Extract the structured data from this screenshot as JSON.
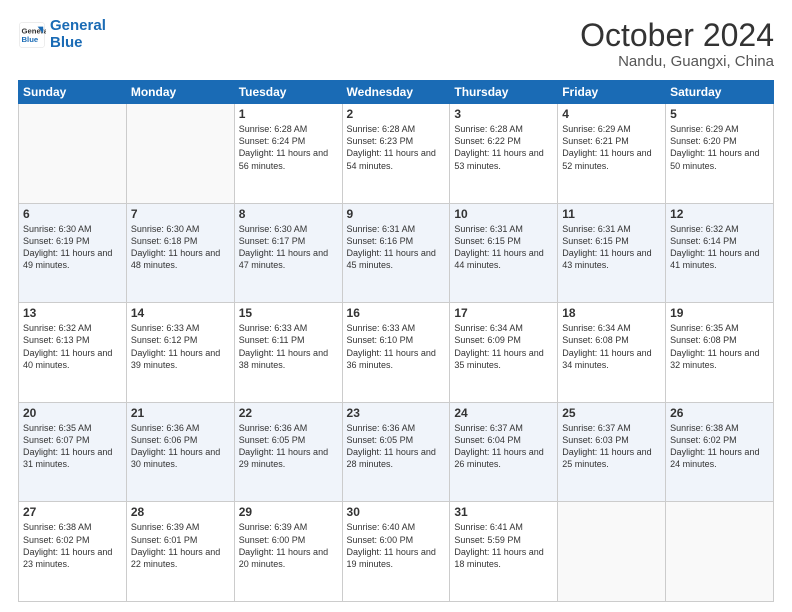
{
  "header": {
    "logo_line1": "General",
    "logo_line2": "Blue",
    "month": "October 2024",
    "location": "Nandu, Guangxi, China"
  },
  "weekdays": [
    "Sunday",
    "Monday",
    "Tuesday",
    "Wednesday",
    "Thursday",
    "Friday",
    "Saturday"
  ],
  "weeks": [
    [
      {
        "day": "",
        "info": ""
      },
      {
        "day": "",
        "info": ""
      },
      {
        "day": "1",
        "info": "Sunrise: 6:28 AM\nSunset: 6:24 PM\nDaylight: 11 hours and 56 minutes."
      },
      {
        "day": "2",
        "info": "Sunrise: 6:28 AM\nSunset: 6:23 PM\nDaylight: 11 hours and 54 minutes."
      },
      {
        "day": "3",
        "info": "Sunrise: 6:28 AM\nSunset: 6:22 PM\nDaylight: 11 hours and 53 minutes."
      },
      {
        "day": "4",
        "info": "Sunrise: 6:29 AM\nSunset: 6:21 PM\nDaylight: 11 hours and 52 minutes."
      },
      {
        "day": "5",
        "info": "Sunrise: 6:29 AM\nSunset: 6:20 PM\nDaylight: 11 hours and 50 minutes."
      }
    ],
    [
      {
        "day": "6",
        "info": "Sunrise: 6:30 AM\nSunset: 6:19 PM\nDaylight: 11 hours and 49 minutes."
      },
      {
        "day": "7",
        "info": "Sunrise: 6:30 AM\nSunset: 6:18 PM\nDaylight: 11 hours and 48 minutes."
      },
      {
        "day": "8",
        "info": "Sunrise: 6:30 AM\nSunset: 6:17 PM\nDaylight: 11 hours and 47 minutes."
      },
      {
        "day": "9",
        "info": "Sunrise: 6:31 AM\nSunset: 6:16 PM\nDaylight: 11 hours and 45 minutes."
      },
      {
        "day": "10",
        "info": "Sunrise: 6:31 AM\nSunset: 6:15 PM\nDaylight: 11 hours and 44 minutes."
      },
      {
        "day": "11",
        "info": "Sunrise: 6:31 AM\nSunset: 6:15 PM\nDaylight: 11 hours and 43 minutes."
      },
      {
        "day": "12",
        "info": "Sunrise: 6:32 AM\nSunset: 6:14 PM\nDaylight: 11 hours and 41 minutes."
      }
    ],
    [
      {
        "day": "13",
        "info": "Sunrise: 6:32 AM\nSunset: 6:13 PM\nDaylight: 11 hours and 40 minutes."
      },
      {
        "day": "14",
        "info": "Sunrise: 6:33 AM\nSunset: 6:12 PM\nDaylight: 11 hours and 39 minutes."
      },
      {
        "day": "15",
        "info": "Sunrise: 6:33 AM\nSunset: 6:11 PM\nDaylight: 11 hours and 38 minutes."
      },
      {
        "day": "16",
        "info": "Sunrise: 6:33 AM\nSunset: 6:10 PM\nDaylight: 11 hours and 36 minutes."
      },
      {
        "day": "17",
        "info": "Sunrise: 6:34 AM\nSunset: 6:09 PM\nDaylight: 11 hours and 35 minutes."
      },
      {
        "day": "18",
        "info": "Sunrise: 6:34 AM\nSunset: 6:08 PM\nDaylight: 11 hours and 34 minutes."
      },
      {
        "day": "19",
        "info": "Sunrise: 6:35 AM\nSunset: 6:08 PM\nDaylight: 11 hours and 32 minutes."
      }
    ],
    [
      {
        "day": "20",
        "info": "Sunrise: 6:35 AM\nSunset: 6:07 PM\nDaylight: 11 hours and 31 minutes."
      },
      {
        "day": "21",
        "info": "Sunrise: 6:36 AM\nSunset: 6:06 PM\nDaylight: 11 hours and 30 minutes."
      },
      {
        "day": "22",
        "info": "Sunrise: 6:36 AM\nSunset: 6:05 PM\nDaylight: 11 hours and 29 minutes."
      },
      {
        "day": "23",
        "info": "Sunrise: 6:36 AM\nSunset: 6:05 PM\nDaylight: 11 hours and 28 minutes."
      },
      {
        "day": "24",
        "info": "Sunrise: 6:37 AM\nSunset: 6:04 PM\nDaylight: 11 hours and 26 minutes."
      },
      {
        "day": "25",
        "info": "Sunrise: 6:37 AM\nSunset: 6:03 PM\nDaylight: 11 hours and 25 minutes."
      },
      {
        "day": "26",
        "info": "Sunrise: 6:38 AM\nSunset: 6:02 PM\nDaylight: 11 hours and 24 minutes."
      }
    ],
    [
      {
        "day": "27",
        "info": "Sunrise: 6:38 AM\nSunset: 6:02 PM\nDaylight: 11 hours and 23 minutes."
      },
      {
        "day": "28",
        "info": "Sunrise: 6:39 AM\nSunset: 6:01 PM\nDaylight: 11 hours and 22 minutes."
      },
      {
        "day": "29",
        "info": "Sunrise: 6:39 AM\nSunset: 6:00 PM\nDaylight: 11 hours and 20 minutes."
      },
      {
        "day": "30",
        "info": "Sunrise: 6:40 AM\nSunset: 6:00 PM\nDaylight: 11 hours and 19 minutes."
      },
      {
        "day": "31",
        "info": "Sunrise: 6:41 AM\nSunset: 5:59 PM\nDaylight: 11 hours and 18 minutes."
      },
      {
        "day": "",
        "info": ""
      },
      {
        "day": "",
        "info": ""
      }
    ]
  ]
}
